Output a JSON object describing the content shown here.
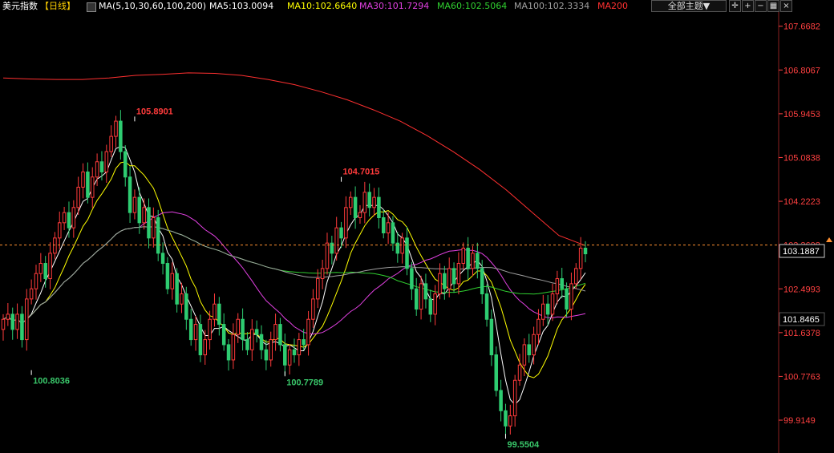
{
  "header": {
    "symbol": "美元指数",
    "period": "【日线】",
    "ma_params": "MA(5,10,30,60,100,200)",
    "ma5": "MA5:103.0094",
    "ma10": "MA10:102.6640",
    "ma30": "MA30:101.7294",
    "ma60": "MA60:102.5064",
    "ma100": "MA100:102.3334",
    "ma200": "MA200",
    "theme_button": "全部主题▼",
    "icons": [
      "crosshair-icon",
      "zoom-in-icon",
      "zoom-out-icon",
      "settings-icon",
      "close-icon"
    ]
  },
  "colors": {
    "background": "#000000",
    "up_candle": "#ff3b3b",
    "down_candle": "#2ecc71",
    "ma5": "#ffffff",
    "ma10": "#ffff00",
    "ma30": "#e040e0",
    "ma60": "#30d030",
    "ma100": "#a0a0a0",
    "ma200": "#ff3030",
    "axis_text": "#ff4040",
    "current_price_line": "#ff9030"
  },
  "chart_data": {
    "type": "candlestick",
    "symbol": "美元指数",
    "period": "日线",
    "ylim": [
      99.3,
      107.9
    ],
    "y_ticks": [
      "107.6682",
      "106.8067",
      "105.9453",
      "105.0838",
      "104.2223",
      "103.3608",
      "102.4993",
      "101.6378",
      "100.7763",
      "99.9149"
    ],
    "current_price": "103.1887",
    "highlighted_price": "101.8465",
    "extreme_labels": [
      {
        "text": "105.8901",
        "type": "high"
      },
      {
        "text": "100.8036",
        "type": "low"
      },
      {
        "text": "100.7789",
        "type": "low"
      },
      {
        "text": "104.7015",
        "type": "high"
      },
      {
        "text": "99.5504",
        "type": "low"
      }
    ],
    "closes": [
      101.9,
      102.0,
      101.7,
      102.0,
      101.5,
      102.3,
      102.5,
      102.8,
      103.0,
      102.7,
      103.2,
      103.5,
      103.8,
      104.0,
      103.7,
      104.1,
      104.5,
      104.8,
      104.3,
      104.7,
      105.0,
      104.8,
      105.2,
      105.5,
      105.8,
      105.2,
      104.7,
      104.0,
      104.3,
      103.8,
      104.1,
      103.5,
      103.9,
      103.2,
      103.0,
      102.5,
      102.8,
      102.2,
      102.4,
      101.9,
      101.5,
      101.8,
      101.2,
      101.5,
      101.9,
      102.2,
      101.8,
      101.4,
      101.1,
      101.6,
      101.9,
      101.5,
      101.3,
      101.7,
      101.6,
      101.3,
      101.1,
      101.5,
      101.8,
      101.4,
      101.0,
      101.3,
      101.2,
      101.5,
      101.4,
      101.9,
      102.3,
      102.7,
      102.9,
      103.4,
      103.2,
      103.7,
      103.5,
      104.1,
      104.3,
      103.9,
      104.0,
      104.4,
      104.1,
      104.3,
      103.9,
      103.6,
      103.8,
      103.4,
      103.2,
      103.5,
      102.9,
      102.5,
      102.1,
      102.6,
      102.3,
      102.0,
      102.4,
      102.8,
      102.5,
      102.9,
      102.6,
      103.0,
      103.3,
      102.9,
      103.2,
      102.9,
      102.4,
      101.9,
      101.2,
      100.5,
      100.1,
      99.8,
      100.0,
      100.7,
      101.0,
      101.4,
      101.2,
      101.6,
      101.9,
      102.2,
      102.0,
      102.4,
      102.7,
      102.5,
      102.1,
      102.6,
      102.9,
      103.3,
      103.1887
    ],
    "series": [
      {
        "name": "MA5",
        "values": "computed from closes (period 5)"
      },
      {
        "name": "MA10",
        "values": "computed from closes (period 10)"
      },
      {
        "name": "MA30",
        "values": "computed from closes (period 30)"
      },
      {
        "name": "MA60",
        "values": "computed from closes (period 60)"
      },
      {
        "name": "MA100",
        "values": "computed from closes (period 100)"
      },
      {
        "name": "MA200",
        "values": [
          106.65,
          106.63,
          106.62,
          106.62,
          106.65,
          106.7,
          106.72,
          106.75,
          106.74,
          106.7,
          106.62,
          106.52,
          106.38,
          106.22,
          106.02,
          105.8,
          105.52,
          105.2,
          104.85,
          104.45,
          104.0,
          103.55,
          103.35
        ]
      }
    ]
  }
}
